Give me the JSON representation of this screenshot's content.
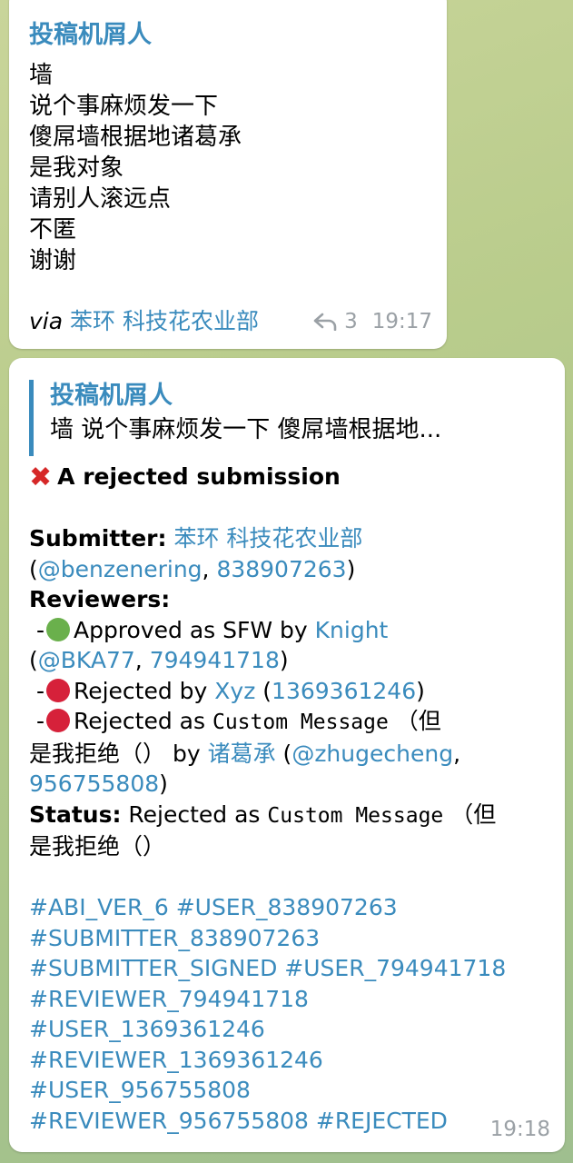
{
  "message1": {
    "sender": "投稿机屑人",
    "lines": [
      "墙",
      "说个事麻烦发一下",
      "傻屌墙根据地诸葛承",
      "是我对象",
      "请别人滚远点",
      "不匿",
      "谢谢"
    ],
    "via_label": "via",
    "via_link": "苯环 科技花农业部",
    "reply_count": "3",
    "time": "19:17"
  },
  "message2": {
    "quote_sender": "投稿机屑人",
    "quote_text": "墙 说个事麻烦发一下 傻屌墙根据地...",
    "heading": "A rejected submission",
    "submitter_label": "Submitter:",
    "submitter_name": "苯环 科技花农业部",
    "submitter_username": "@benzenering",
    "submitter_id": "838907263",
    "reviewers_label": "Reviewers:",
    "reviewers": [
      {
        "status_color": "#6ab04c",
        "action": "Approved as SFW by",
        "name": "Knight",
        "username": "@BKA77",
        "id": "794941718"
      },
      {
        "status_color": "#d6213a",
        "action": "Rejected by",
        "name": "Xyz",
        "id": "1369361246"
      },
      {
        "status_color": "#d6213a",
        "action": "Rejected as",
        "reason_code": "Custom Message",
        "reason_paren": "（但",
        "reason_cont": "是我拒绝（）",
        "by": "by",
        "name": "诸葛承",
        "username": "@zhugecheng",
        "id": "956755808"
      }
    ],
    "status_label": "Status:",
    "status_text": "Rejected as",
    "status_code": "Custom Message",
    "status_paren": "（但",
    "status_cont": "是我拒绝（）",
    "tag_lines": [
      "#ABI_VER_6 #USER_838907263",
      "#SUBMITTER_838907263",
      "#SUBMITTER_SIGNED #USER_794941718",
      "#REVIEWER_794941718",
      "#USER_1369361246",
      "#REVIEWER_1369361246",
      "#USER_956755808",
      "#REVIEWER_956755808 #REJECTED"
    ],
    "time": "19:18"
  }
}
